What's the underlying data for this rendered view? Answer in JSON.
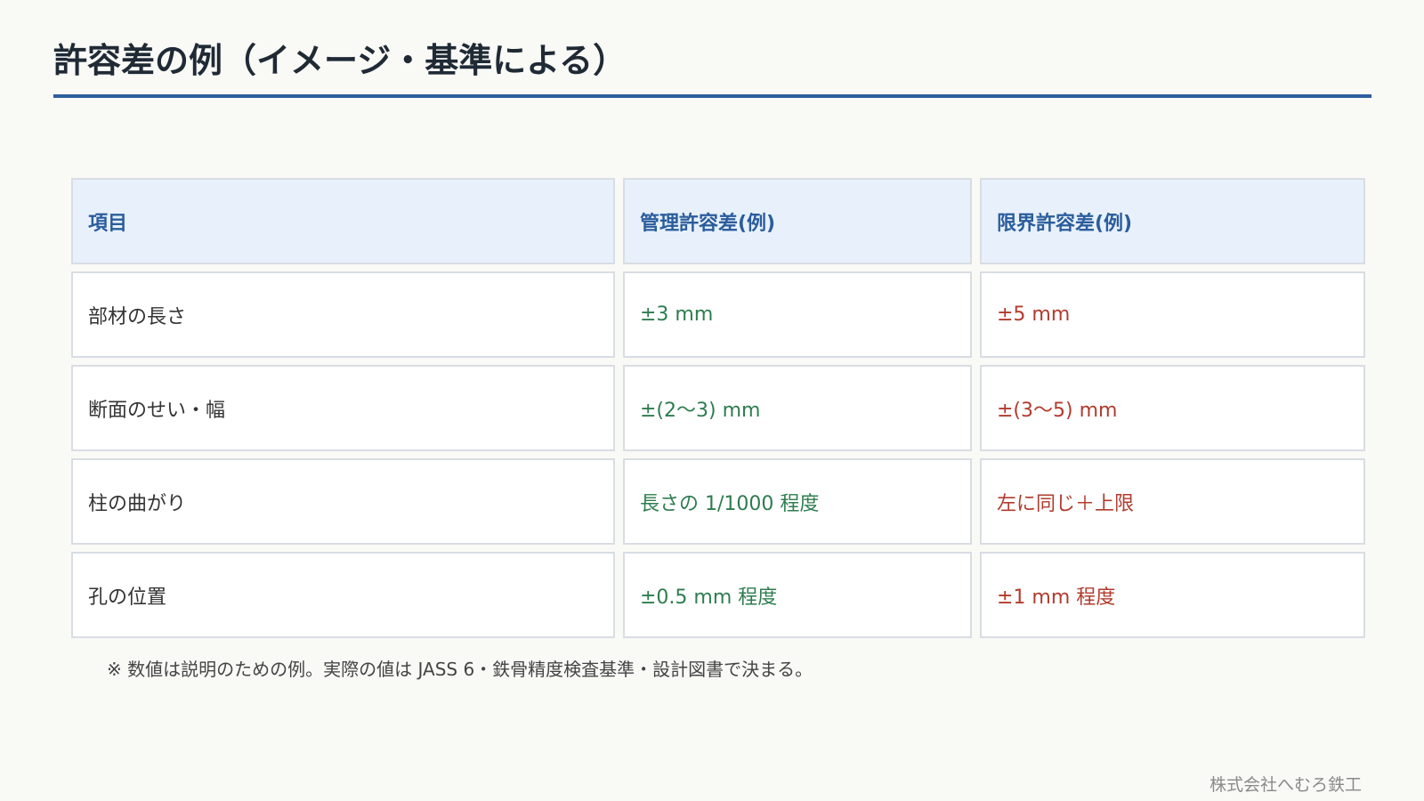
{
  "page": {
    "title": "許容差の例（イメージ・基準による）",
    "note": "※ 数値は説明のための例。実際の値は JASS 6・鉄骨精度検査基準・設計図書で決まる。",
    "footer": "株式会社へむろ鉄工"
  },
  "table": {
    "headers": [
      "項目",
      "管理許容差(例)",
      "限界許容差(例)"
    ],
    "rows": [
      [
        "部材の長さ",
        "±3 mm",
        "±5 mm"
      ],
      [
        "断面のせい・幅",
        "±(2〜3) mm",
        "±(3〜5) mm"
      ],
      [
        "柱の曲がり",
        "長さの 1/1000 程度",
        "左に同じ＋上限"
      ],
      [
        "孔の位置",
        "±0.5 mm 程度",
        "±1 mm 程度"
      ]
    ]
  },
  "colors": {
    "accent": "#2e5e9e",
    "header_bg": "#e8f1fb",
    "management_text": "#2e7d4f",
    "limit_text": "#b23b2e"
  }
}
